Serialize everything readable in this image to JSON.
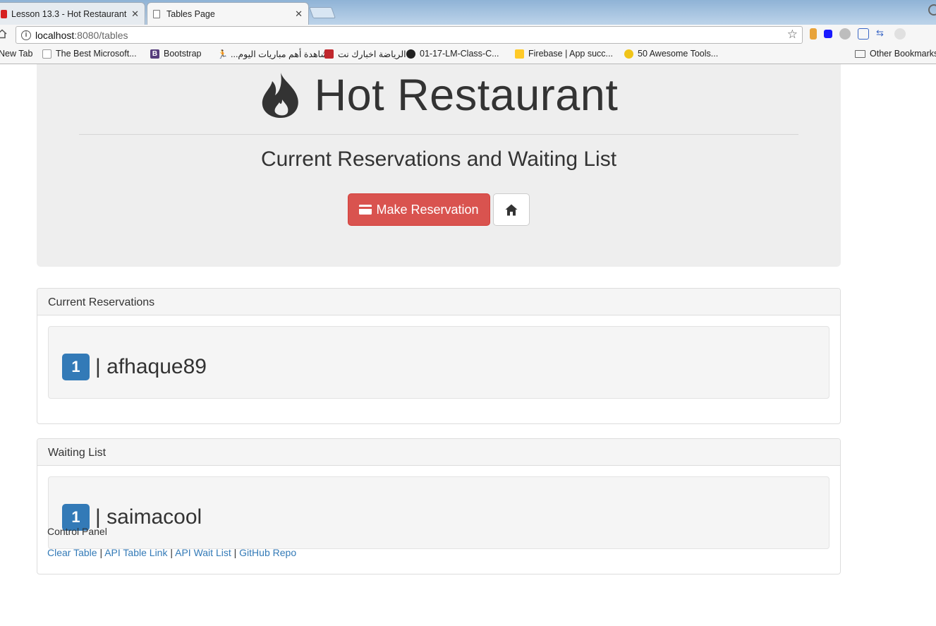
{
  "browser": {
    "tabs": [
      {
        "title": "Lesson 13.3 - Hot Restaurant",
        "close": "✕"
      },
      {
        "title": "Tables Page",
        "close": "✕"
      }
    ],
    "url": {
      "host": "localhost",
      "rest": ":8080/tables"
    },
    "bookmarks": [
      "New Tab",
      "The Best Microsoft...",
      "Bootstrap",
      "مشاهدة أهم مباريات اليوم...",
      "الرياضة اخبارك نت",
      "01-17-LM-Class-C...",
      "Firebase | App succ...",
      "50 Awesome Tools...",
      "Other Bookmarks"
    ]
  },
  "header": {
    "title": "Hot Restaurant",
    "subtitle": "Current Reservations and Waiting List",
    "reserve_button": "Make Reservation"
  },
  "reservations": {
    "heading": "Current Reservations",
    "items": [
      {
        "number": "1",
        "name": "| afhaque89"
      }
    ]
  },
  "waitlist": {
    "heading": "Waiting List",
    "items": [
      {
        "number": "1",
        "name": "| saimacool"
      }
    ]
  },
  "footer": {
    "label": "Control Panel",
    "links": [
      "Clear Table",
      "API Table Link",
      "API Wait List",
      "GitHub Repo"
    ],
    "separator": " | "
  },
  "colors": {
    "danger": "#d9534f",
    "primary": "#337ab7",
    "jumbotron": "#eeeeee"
  }
}
